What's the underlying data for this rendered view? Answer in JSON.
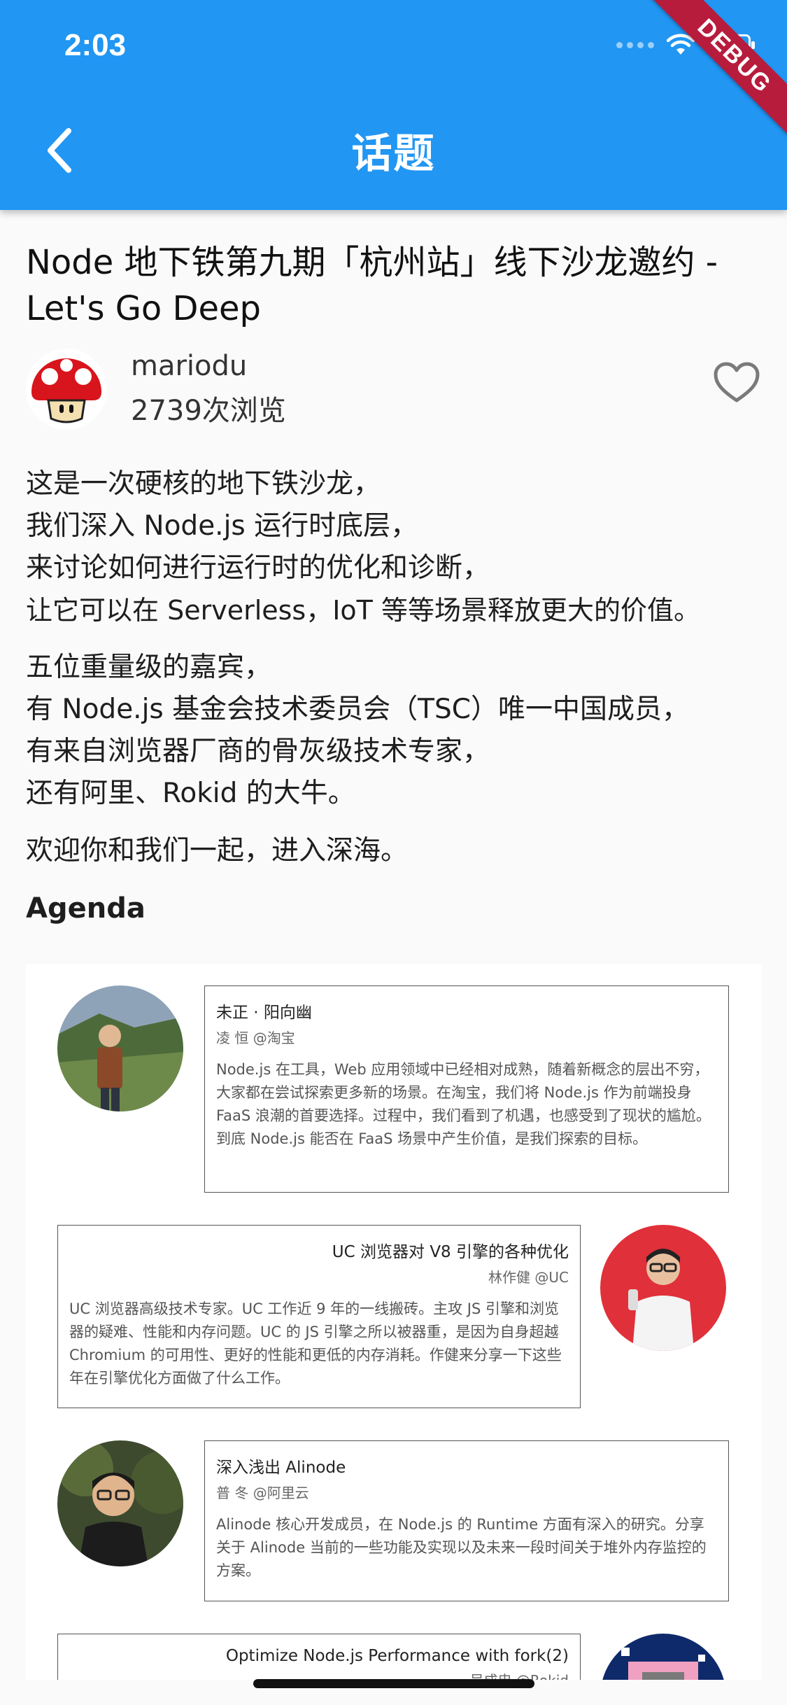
{
  "status_bar": {
    "time": "2:03"
  },
  "debug_banner": "DEBUG",
  "appbar": {
    "title": "话题"
  },
  "topic": {
    "title": "Node 地下铁第九期「杭州站」线下沙龙邀约 - Let's Go Deep",
    "author": "mariodu",
    "views": "2739次浏览"
  },
  "body": {
    "p1": [
      "这是一次硬核的地下铁沙龙，",
      "我们深入 Node.js 运行时底层，",
      "来讨论如何进行运行时的优化和诊断，",
      "让它可以在 Serverless，IoT 等等场景释放更大的价值。"
    ],
    "p2": [
      "五位重量级的嘉宾，",
      "有 Node.js 基金会技术委员会（TSC）唯一中国成员，",
      "有来自浏览器厂商的骨灰级技术专家，",
      "还有阿里、Rokid 的大牛。"
    ],
    "p3": "欢迎你和我们一起，进入深海。",
    "agenda_heading": "Agenda"
  },
  "agenda": [
    {
      "title": "未正 · 阳向幽",
      "speaker": "凌 恒 @淘宝",
      "desc": "Node.js 在工具，Web 应用领域中已经相对成熟，随着新概念的层出不穷，大家都在尝试探索更多新的场景。在淘宝，我们将 Node.js 作为前端投身 FaaS 浪潮的首要选择。过程中，我们看到了机遇，也感受到了现状的尴尬。到底 Node.js 能否在 FaaS 场景中产生价值，是我们探索的目标。"
    },
    {
      "title": "UC 浏览器对 V8 引擎的各种优化",
      "speaker": "林作健 @UC",
      "desc": "UC 浏览器高级技术专家。UC 工作近 9 年的一线搬砖。主攻 JS 引擎和浏览器的疑难、性能和内存问题。UC 的 JS 引擎之所以被器重，是因为自身超越 Chromium 的可用性、更好的性能和更低的内存消耗。作健来分享一下这些年在引擎优化方面做了什么工作。"
    },
    {
      "title": "深入浅出 Alinode",
      "speaker": "普 冬 @阿里云",
      "desc": "Alinode 核心开发成员，在 Node.js 的 Runtime 方面有深入的研究。分享关于 Alinode 当前的一些功能及实现以及未来一段时间关于堆外内存监控的方案。"
    },
    {
      "title": "Optimize Node.js Performance with fork(2)",
      "speaker": "吴成忠 @Rokid"
    }
  ],
  "colors": {
    "primary": "#2196F3",
    "debug": "#b71c3c"
  },
  "icons": {
    "back": "chevron-left-icon",
    "favorite": "heart-outline-icon",
    "wifi": "wifi-icon",
    "battery": "battery-icon"
  }
}
